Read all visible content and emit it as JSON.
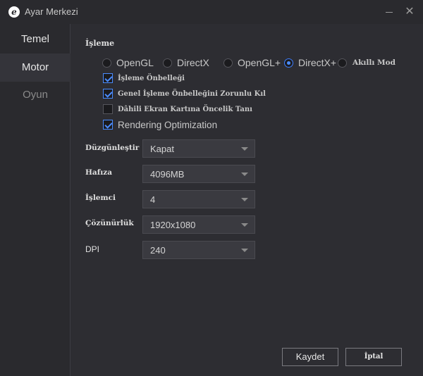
{
  "window": {
    "title": "Ayar Merkezi",
    "logo_glyph": "e",
    "minimize_icon": "minimize-icon",
    "close_glyph": "✕"
  },
  "sidebar": {
    "items": [
      {
        "label": "Temel",
        "active": false
      },
      {
        "label": "Motor",
        "active": true
      },
      {
        "label": "Oyun",
        "active": false
      }
    ]
  },
  "render": {
    "section_label": "İşleme",
    "modes": [
      {
        "label": "OpenGL",
        "checked": false
      },
      {
        "label": "DirectX",
        "checked": false
      },
      {
        "label": "OpenGL+",
        "checked": false
      },
      {
        "label": "DirectX+",
        "checked": true
      },
      {
        "label": "Akıllı Mod",
        "checked": false
      }
    ],
    "options": [
      {
        "label": "İşleme Önbelleği",
        "checked": true
      },
      {
        "label": "Genel İşleme Önbelleğini Zorunlu Kıl",
        "checked": true
      },
      {
        "label": "Dâhili Ekran Kartına Öncelik Tanı",
        "checked": false
      },
      {
        "label": "Rendering Optimization",
        "checked": true
      }
    ]
  },
  "fields": [
    {
      "label": "Düzgünleştir",
      "value": "Kapat"
    },
    {
      "label": "Hafıza",
      "value": "4096MB"
    },
    {
      "label": "İşlemci",
      "value": "4"
    },
    {
      "label": "Çözünürlük",
      "value": "1920x1080"
    },
    {
      "label": "DPI",
      "value": "240"
    }
  ],
  "buttons": {
    "save": "Kaydet",
    "cancel": "İptal"
  },
  "colors": {
    "accent": "#4a8cff",
    "background": "#2d2d32",
    "sidebar": "#2a2a2e"
  }
}
